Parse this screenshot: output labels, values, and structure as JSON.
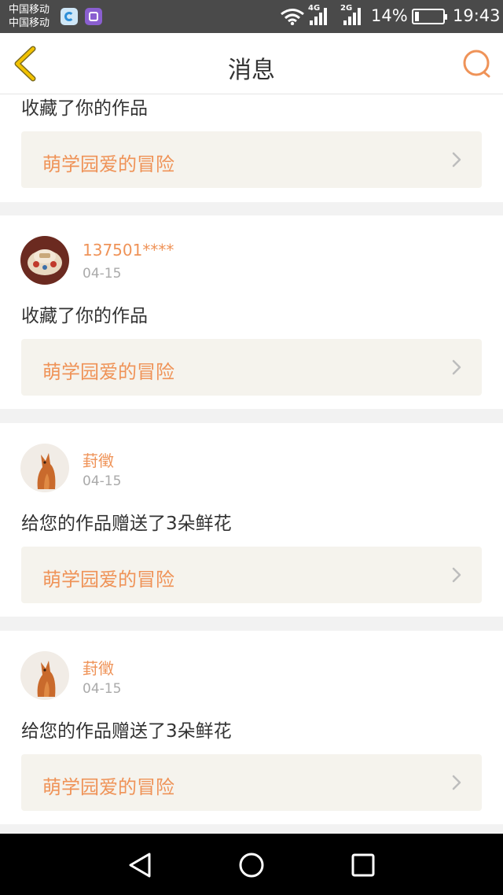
{
  "status_bar": {
    "carrier1": "中国移动",
    "carrier2": "中国移动",
    "net1": "4G",
    "net2": "2G",
    "battery_percent": "14%",
    "battery_level": 0.14,
    "time": "19:43"
  },
  "header": {
    "title": "消息",
    "back_icon": "back-chevron-icon",
    "search_icon": "search-icon"
  },
  "colors": {
    "accent": "#ef9358",
    "back": "#e8b400",
    "link_bg": "#f5f3ed"
  },
  "messages": [
    {
      "username": "",
      "date": "",
      "action": "收藏了你的作品",
      "work": "萌学园爱的冒险"
    },
    {
      "username": "137501****",
      "date": "04-15",
      "action": "收藏了你的作品",
      "work": "萌学园爱的冒险"
    },
    {
      "username": "葑徵",
      "date": "04-15",
      "action": "给您的作品赠送了3朵鲜花",
      "work": "萌学园爱的冒险"
    },
    {
      "username": "葑徵",
      "date": "04-15",
      "action": "给您的作品赠送了3朵鲜花",
      "work": "萌学园爱的冒险"
    }
  ],
  "nav": {
    "back_icon": "triangle-back-icon",
    "home_icon": "circle-home-icon",
    "recents_icon": "square-recents-icon"
  }
}
